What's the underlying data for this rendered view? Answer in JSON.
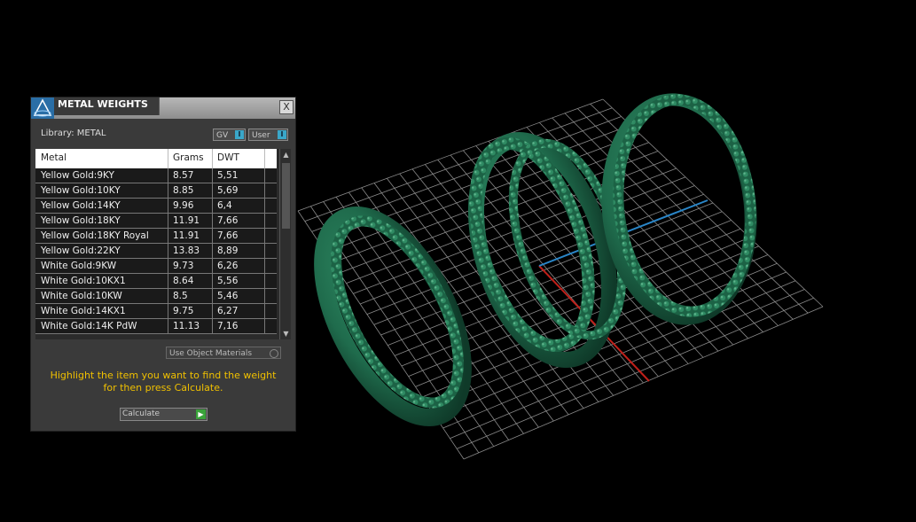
{
  "panel": {
    "title": "METAL WEIGHTS",
    "close_label": "X",
    "library_label": "Library: METAL",
    "toggles": [
      {
        "label": "GV",
        "indicator": "I"
      },
      {
        "label": "User",
        "indicator": "I"
      }
    ],
    "table": {
      "headers": [
        "Metal",
        "Grams",
        "DWT"
      ],
      "rows": [
        [
          "Yellow Gold:9KY",
          "8.57",
          "5,51"
        ],
        [
          "Yellow Gold:10KY",
          "8.85",
          "5,69"
        ],
        [
          "Yellow Gold:14KY",
          "9.96",
          "6,4"
        ],
        [
          "Yellow Gold:18KY",
          "11.91",
          "7,66"
        ],
        [
          "Yellow Gold:18KY Royal",
          "11.91",
          "7,66"
        ],
        [
          "Yellow Gold:22KY",
          "13.83",
          "8,89"
        ],
        [
          "White Gold:9KW",
          "9.73",
          "6,26"
        ],
        [
          "White Gold:10KX1",
          "8.64",
          "5,56"
        ],
        [
          "White Gold:10KW",
          "8.5",
          "5,46"
        ],
        [
          "White Gold:14KX1",
          "9.75",
          "6,27"
        ],
        [
          "White Gold:14K PdW",
          "11.13",
          "7,16"
        ]
      ]
    },
    "use_object_materials": "Use Object Materials",
    "instructions_line1": "Highlight the item you want to find the weight",
    "instructions_line2": "for then press Calculate.",
    "calculate_label": "Calculate",
    "colors": {
      "instruction_text": "#f0c000",
      "accent_toggle": "#3aa7c9",
      "calculate_arrow": "#3aa33a",
      "ring_green": "#1f6b4c"
    }
  },
  "viewport": {
    "model": "three-ring-set",
    "icons": [
      "logo-icon",
      "close-icon",
      "scroll-up-icon",
      "scroll-down-icon",
      "play-arrow-icon"
    ]
  }
}
